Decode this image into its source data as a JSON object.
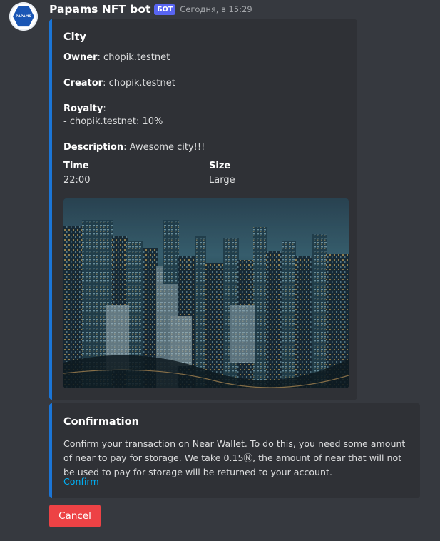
{
  "message": {
    "author": "Papams NFT bot",
    "bot_tag": "БОТ",
    "timestamp": "Сегодня, в 15:29",
    "avatar_text": "PAPAMS"
  },
  "nft_embed": {
    "title": "City",
    "owner_label": "Owner",
    "owner_value": ": chopik.testnet",
    "creator_label": "Creator",
    "creator_value": ": chopik.testnet",
    "royalty_label": "Royalty",
    "royalty_colon": ":",
    "royalty_item": "- chopik.testnet: 10%",
    "description_label": "Description",
    "description_value": ": Awesome city!!!",
    "fields": [
      {
        "name": "Time",
        "value": "22:00"
      },
      {
        "name": "Size",
        "value": "Large"
      }
    ],
    "image_subject": "aerial night city skyline"
  },
  "confirm_embed": {
    "title": "Confirmation",
    "text": "Confirm your transaction on Near Wallet. To do this, you need some amount of near to pay for storage. We take 0.15Ⓝ, the amount of near that will not be used to pay for storage will be returned to your account.",
    "link_label": "Confirm"
  },
  "buttons": {
    "cancel_label": "Cancel"
  },
  "colors": {
    "background": "#36393f",
    "embed_background": "#2f3136",
    "embed_accent": "#1b75d6",
    "bot_tag": "#5865f2",
    "link": "#00aff4",
    "cancel_button": "#ed4245"
  }
}
